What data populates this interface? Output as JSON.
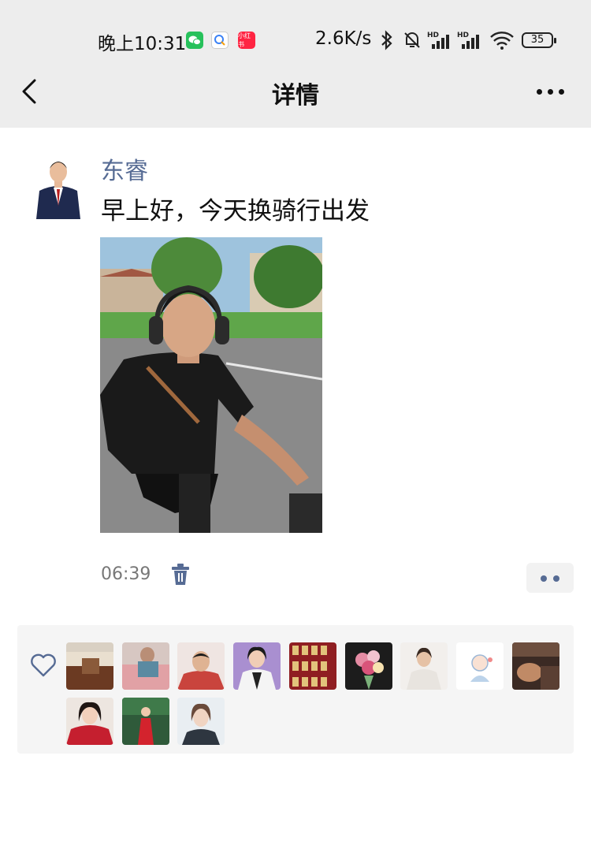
{
  "status_bar": {
    "time": "晚上10:31",
    "apps": [
      {
        "name": "wechat-icon",
        "label": ""
      },
      {
        "name": "search-app-icon",
        "label": ""
      },
      {
        "name": "xiaohongshu-icon",
        "label": "小红书"
      }
    ],
    "network_speed": "2.6K/s",
    "battery": "35",
    "colors": {
      "bar": "#ededed"
    }
  },
  "header": {
    "title": "详情"
  },
  "post": {
    "author": "东睿",
    "text": "早上好，今天换骑行出发",
    "time": "06:39",
    "colors": {
      "author": "#566b94"
    }
  },
  "likes": {
    "icon": "heart-icon",
    "avatars": [
      {
        "name": "like-avatar-1"
      },
      {
        "name": "like-avatar-2"
      },
      {
        "name": "like-avatar-3"
      },
      {
        "name": "like-avatar-4"
      },
      {
        "name": "like-avatar-5"
      },
      {
        "name": "like-avatar-6"
      },
      {
        "name": "like-avatar-7"
      },
      {
        "name": "like-avatar-8"
      },
      {
        "name": "like-avatar-9"
      },
      {
        "name": "like-avatar-10"
      },
      {
        "name": "like-avatar-11"
      },
      {
        "name": "like-avatar-12"
      }
    ]
  }
}
